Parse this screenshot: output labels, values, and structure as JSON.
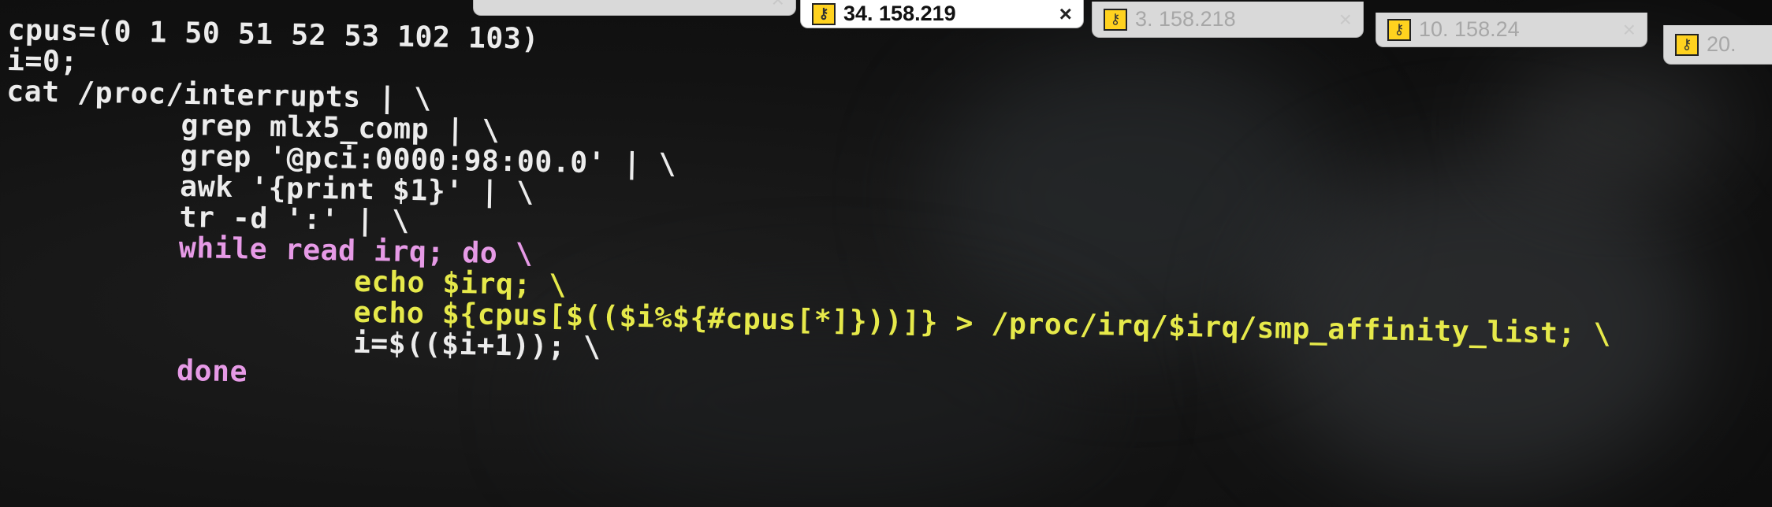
{
  "tabs": [
    {
      "label": "34. 158.219",
      "close": "×"
    },
    {
      "label": "3. 158.218",
      "close": "×"
    },
    {
      "label": "10. 158.24",
      "close": "×"
    },
    {
      "label": "20.",
      "close": ""
    }
  ],
  "terminal": {
    "lines": [
      "cpus=(0 1 50 51 52 53 102 103)",
      "i=0;",
      "cat /proc/interrupts | \\",
      "grep mlx5_comp | \\",
      "grep '@pci:0000:98:00.0' | \\",
      "awk '{print $1}' | \\",
      "tr -d ':' | \\",
      "while read irq; do \\",
      "echo $irq; \\",
      "echo ${cpus[$(($i%${#cpus[*]}))]} > /proc/irq/$irq/smp_affinity_list; \\",
      "i=$(($i+1)); \\",
      "done"
    ]
  }
}
